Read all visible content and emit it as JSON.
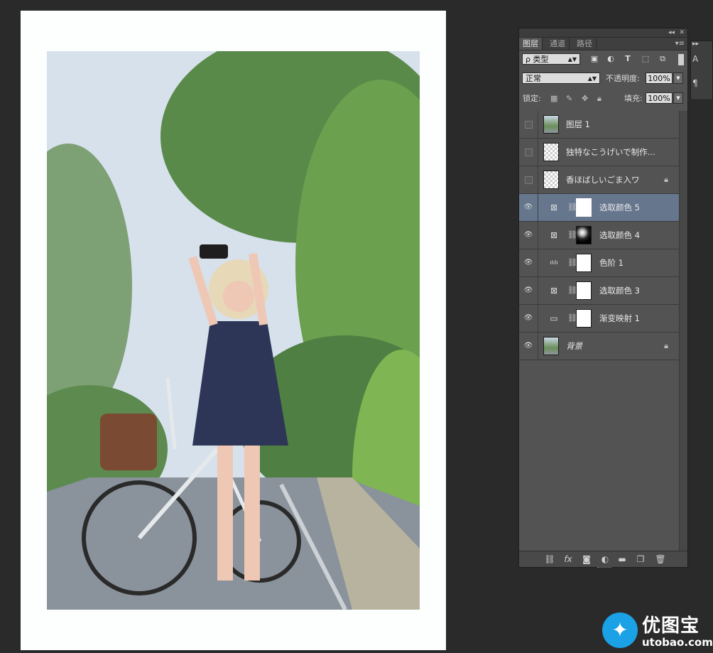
{
  "panel": {
    "collapse_glyph": "◂◂",
    "close_glyph": "✕",
    "tabs": [
      {
        "label": "图层",
        "active": true
      },
      {
        "label": "通道",
        "active": false
      },
      {
        "label": "路径",
        "active": false
      }
    ],
    "menu_glyph": "▾≡",
    "filter": {
      "value": "ρ 类型",
      "icons": [
        {
          "name": "image-filter-icon",
          "glyph": "▣"
        },
        {
          "name": "adjustment-filter-icon",
          "glyph": "◐"
        },
        {
          "name": "type-filter-icon",
          "glyph": "T"
        },
        {
          "name": "shape-filter-icon",
          "glyph": "⬚"
        },
        {
          "name": "smart-object-filter-icon",
          "glyph": "⧉"
        }
      ]
    },
    "blend_mode": "正常",
    "opacity_label": "不透明度:",
    "opacity_value": "100%",
    "lock_label": "锁定:",
    "fill_label": "填充:",
    "fill_value": "100%",
    "layers": [
      {
        "name": "图层 1",
        "visible": false,
        "thumb": "photoT",
        "kind": "pixel",
        "locked": false,
        "selected": false
      },
      {
        "name": "独特なこうげいで制作...",
        "visible": false,
        "thumb": "trans",
        "kind": "text",
        "locked": false,
        "selected": false
      },
      {
        "name": "香ほばしいごま入ワ",
        "visible": false,
        "thumb": "trans",
        "kind": "text",
        "locked": true,
        "selected": false
      },
      {
        "name": "选取颜色 5",
        "visible": true,
        "thumb": "white",
        "kind": "selective-color",
        "locked": false,
        "selected": true
      },
      {
        "name": "选取颜色 4",
        "visible": true,
        "thumb": "dark",
        "kind": "selective-color",
        "locked": false,
        "selected": false
      },
      {
        "name": "色阶 1",
        "visible": true,
        "thumb": "white",
        "kind": "levels",
        "locked": false,
        "selected": false
      },
      {
        "name": "选取颜色 3",
        "visible": true,
        "thumb": "white",
        "kind": "selective-color",
        "locked": false,
        "selected": false
      },
      {
        "name": "渐变映射 1",
        "visible": true,
        "thumb": "white",
        "kind": "gradient-map",
        "locked": false,
        "selected": false
      },
      {
        "name": "背景",
        "visible": true,
        "thumb": "photoT",
        "kind": "background",
        "locked": true,
        "selected": false
      }
    ],
    "footer_icons": [
      {
        "name": "link-layers-icon",
        "glyph": "⛓"
      },
      {
        "name": "fx-icon",
        "glyph": "fx"
      },
      {
        "name": "add-mask-icon",
        "glyph": "◙"
      },
      {
        "name": "new-adjustment-icon",
        "glyph": "◐"
      },
      {
        "name": "new-group-icon",
        "glyph": "▬"
      },
      {
        "name": "new-layer-icon",
        "glyph": "❐"
      },
      {
        "name": "trash-icon",
        "glyph": "🗑"
      }
    ]
  },
  "watermark": {
    "cn": "优图宝",
    "en": "utobao.com"
  },
  "colors": {
    "selected_layer": "#65768d",
    "panel_bg": "#535353",
    "workspace": "#2a2a2a",
    "brand_blue": "#1aa1e6"
  }
}
